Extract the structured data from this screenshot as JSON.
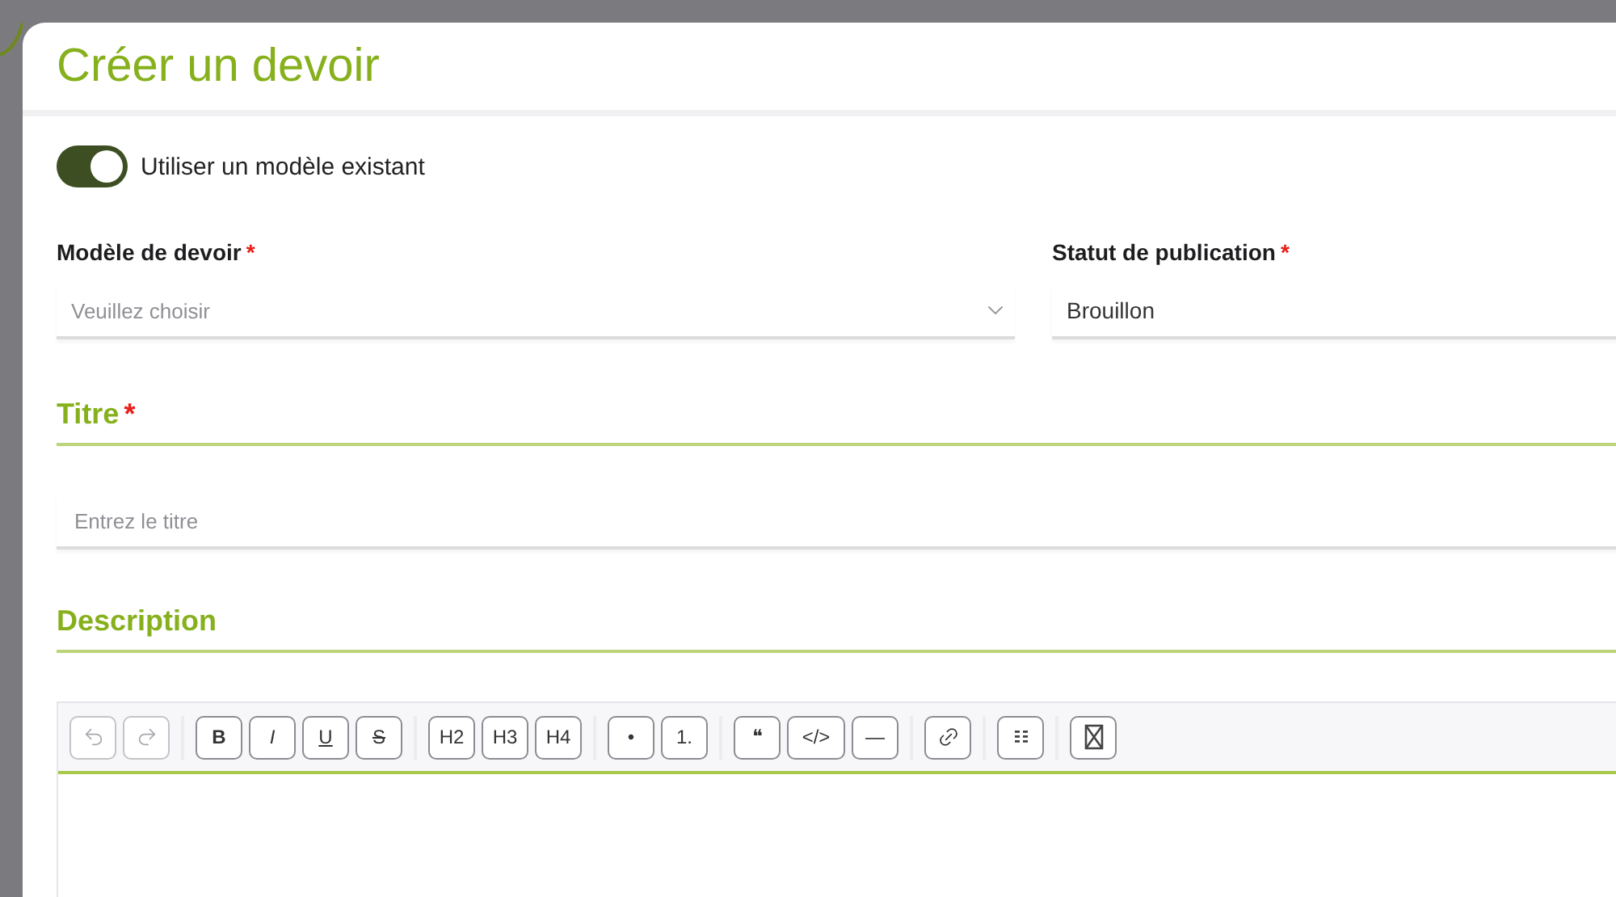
{
  "dialog": {
    "title": "Créer un devoir"
  },
  "toggle": {
    "label": "Utiliser un modèle existant",
    "on": true
  },
  "fields": [
    {
      "label": "Modèle de devoir",
      "required_mark": "*",
      "kind": "select",
      "placeholder": "Veuillez choisir"
    },
    {
      "label": "Statut de publication",
      "required_mark": "*",
      "kind": "value",
      "value": "Brouillon"
    }
  ],
  "title_section": {
    "heading": "Titre",
    "required_mark": "*",
    "placeholder": "Entrez le titre"
  },
  "description_section": {
    "heading": "Description"
  },
  "toolbar": [
    [
      {
        "kind": "icon",
        "disabled": true
      },
      {
        "kind": "icon",
        "disabled": true
      }
    ],
    [
      {
        "kind": "text",
        "label": "B",
        "disabled": false
      },
      {
        "kind": "text",
        "label": "I",
        "disabled": false
      },
      {
        "kind": "text",
        "label": "U",
        "disabled": false
      },
      {
        "kind": "text",
        "label": "S",
        "disabled": false
      }
    ],
    [
      {
        "kind": "text",
        "label": "H2",
        "disabled": false
      },
      {
        "kind": "text",
        "label": "H3",
        "disabled": false
      },
      {
        "kind": "text",
        "label": "H4",
        "disabled": false
      }
    ],
    [
      {
        "kind": "text",
        "label": "•",
        "disabled": false
      },
      {
        "kind": "text",
        "label": "1.",
        "disabled": false
      }
    ],
    [
      {
        "kind": "text",
        "label": "❝",
        "disabled": false
      },
      {
        "kind": "text",
        "label": "</>",
        "disabled": false
      },
      {
        "kind": "text",
        "label": "—",
        "disabled": false
      }
    ],
    [
      {
        "kind": "icon",
        "disabled": false
      }
    ],
    [
      {
        "kind": "icon",
        "disabled": false
      }
    ],
    [
      {
        "kind": "icon",
        "disabled": false
      }
    ]
  ]
}
